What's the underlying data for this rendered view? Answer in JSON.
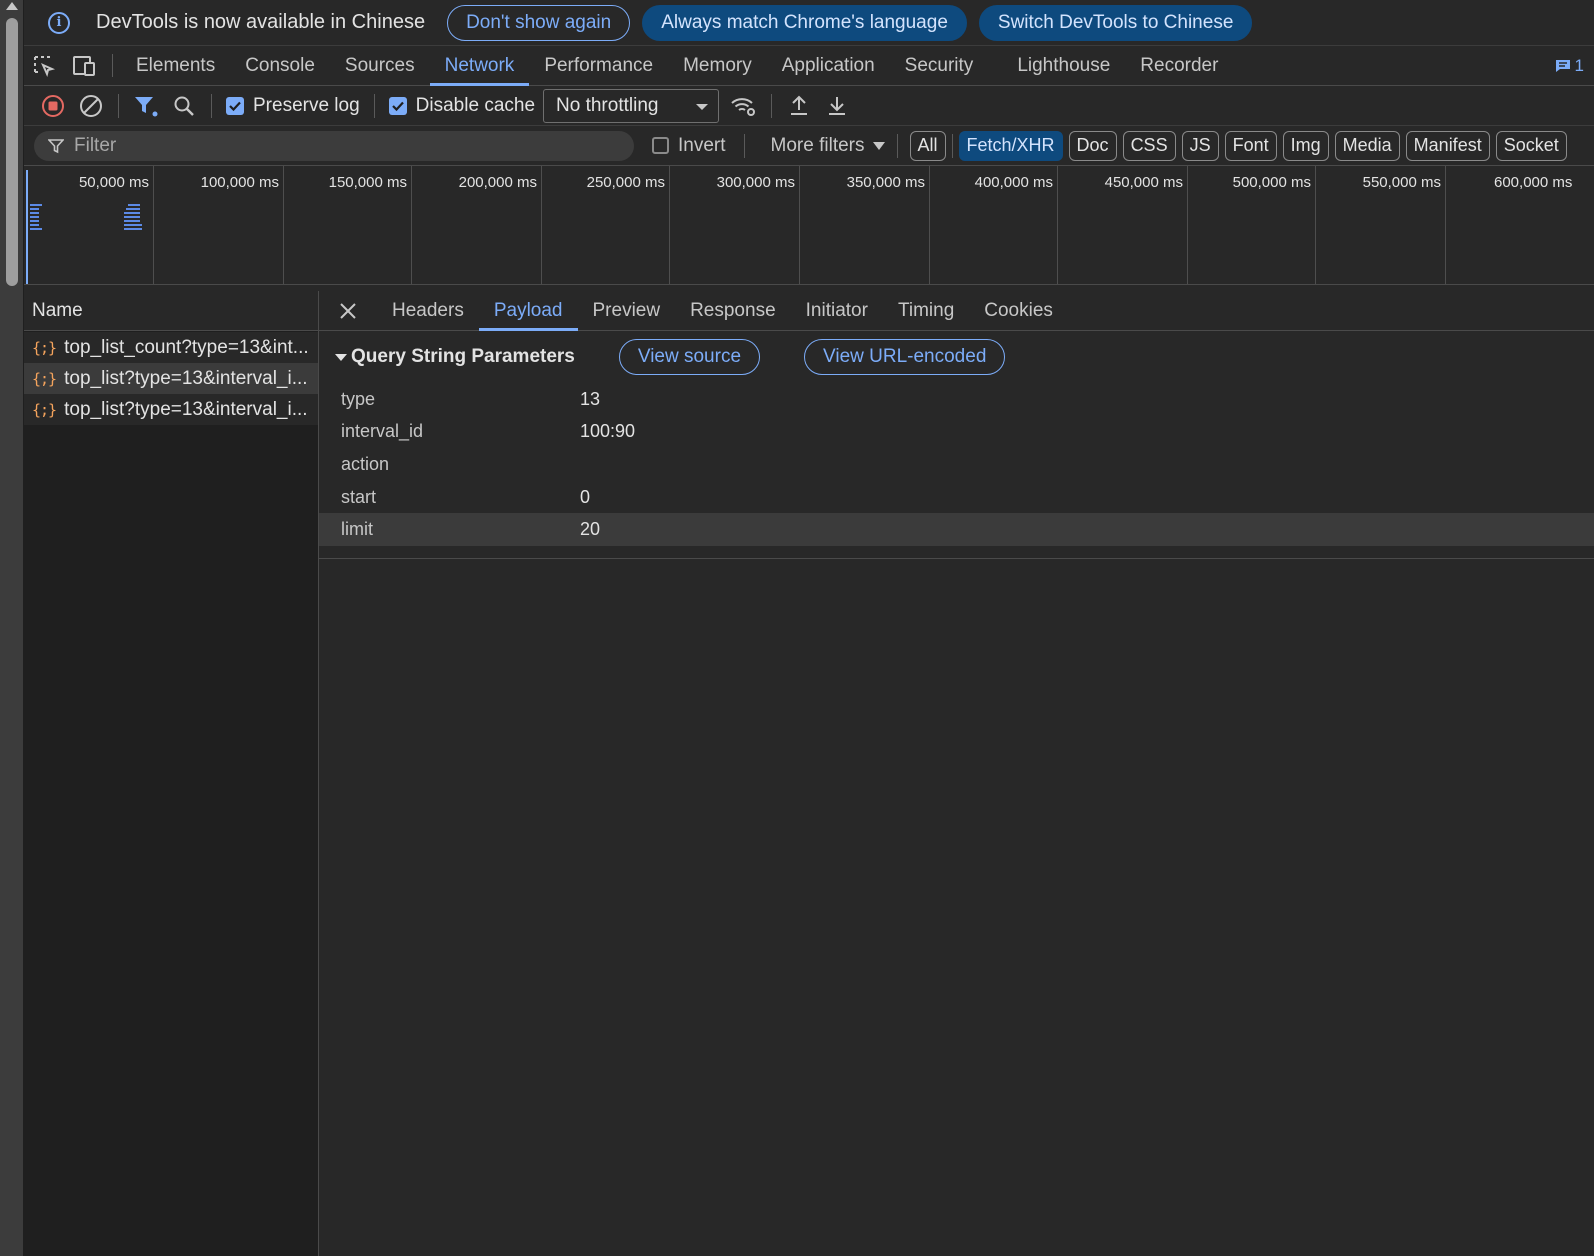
{
  "infobar": {
    "message": "DevTools is now available in Chinese",
    "dont_show": "Don't show again",
    "always_match": "Always match Chrome's language",
    "switch": "Switch DevTools to Chinese"
  },
  "tabs": [
    "Elements",
    "Console",
    "Sources",
    "Network",
    "Performance",
    "Memory",
    "Application",
    "Security",
    "Lighthouse",
    "Recorder"
  ],
  "active_tab": "Network",
  "issues_count": "1",
  "toolbar": {
    "preserve_log": "Preserve log",
    "preserve_log_checked": true,
    "disable_cache": "Disable cache",
    "disable_cache_checked": true,
    "throttling": "No throttling"
  },
  "filterbar": {
    "placeholder": "Filter",
    "invert": "Invert",
    "more_filters": "More filters",
    "types": [
      "All",
      "Fetch/XHR",
      "Doc",
      "CSS",
      "JS",
      "Font",
      "Img",
      "Media",
      "Manifest",
      "Socket"
    ],
    "active_type": "Fetch/XHR"
  },
  "overview": {
    "ticks": [
      "50,000 ms",
      "100,000 ms",
      "150,000 ms",
      "200,000 ms",
      "250,000 ms",
      "300,000 ms",
      "350,000 ms",
      "400,000 ms",
      "450,000 ms",
      "500,000 ms",
      "550,000 ms",
      "600,000 ms"
    ]
  },
  "requests": {
    "header": "Name",
    "items": [
      {
        "icon": "{;}",
        "name": "top_list_count?type=13&int..."
      },
      {
        "icon": "{;}",
        "name": "top_list?type=13&interval_i..."
      },
      {
        "icon": "{;}",
        "name": "top_list?type=13&interval_i..."
      }
    ]
  },
  "detail": {
    "tabs": [
      "Headers",
      "Payload",
      "Preview",
      "Response",
      "Initiator",
      "Timing",
      "Cookies"
    ],
    "active_tab": "Payload",
    "section_title": "Query String Parameters",
    "view_source": "View source",
    "view_url_encoded": "View URL-encoded",
    "params": [
      {
        "key": "type",
        "value": "13"
      },
      {
        "key": "interval_id",
        "value": "100:90"
      },
      {
        "key": "action",
        "value": ""
      },
      {
        "key": "start",
        "value": "0"
      },
      {
        "key": "limit",
        "value": "20"
      }
    ]
  },
  "colors": {
    "accent": "#7cacf8",
    "record": "#e46962",
    "json_icon": "#f5a45d"
  }
}
